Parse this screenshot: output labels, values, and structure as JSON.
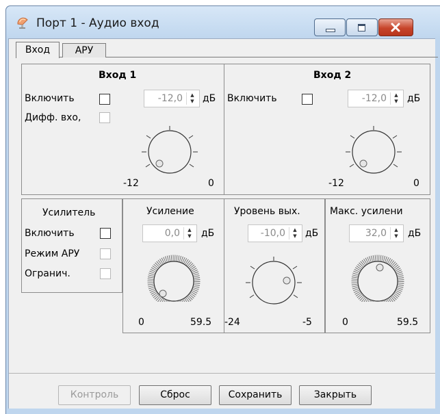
{
  "window": {
    "title": "Порт 1 - Аудио вход",
    "icon": "satellite-dish-icon",
    "controls": [
      "minimize-icon",
      "maximize-icon",
      "close-icon"
    ]
  },
  "tabs": [
    {
      "label": "Вход",
      "active": true
    },
    {
      "label": "АРУ",
      "active": false
    }
  ],
  "input1": {
    "title": "Вход 1",
    "enable_label": "Включить",
    "diff_label": "Дифф. вхо,",
    "value": "-12,0",
    "unit": "дБ",
    "scale_min": "-12",
    "scale_max": "0"
  },
  "input2": {
    "title": "Вход 2",
    "enable_label": "Включить",
    "value": "-12,0",
    "unit": "дБ",
    "scale_min": "-12",
    "scale_max": "0"
  },
  "amplifier": {
    "title": "Усилитель",
    "enable_label": "Включить",
    "agc_label": "Режим АРУ",
    "limit_label": "Огранич."
  },
  "gain": {
    "title": "Усиление",
    "value": "0,0",
    "unit": "дБ",
    "scale_min": "0",
    "scale_max": "59.5"
  },
  "output_level": {
    "title": "Уровень вых.",
    "value": "-10,0",
    "unit": "дБ",
    "scale_min": "-24",
    "scale_max": "-5"
  },
  "max_gain": {
    "title": "Макс. усилени",
    "value": "32,0",
    "unit": "дБ",
    "scale_min": "0",
    "scale_max": "59.5"
  },
  "buttons": {
    "control": "Контроль",
    "reset": "Сброс",
    "save": "Сохранить",
    "close": "Закрыть"
  }
}
